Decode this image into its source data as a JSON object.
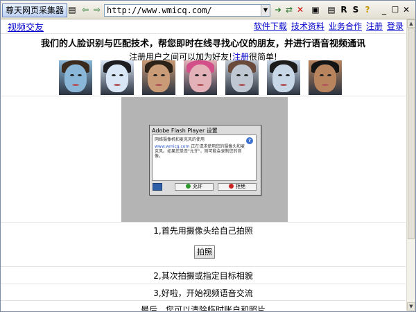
{
  "app": {
    "title": "尊天网页采集器",
    "url": "http://www.wmicq.com/"
  },
  "nav": {
    "brand": "视频交友",
    "links": [
      "软件下载",
      "技术资料",
      "业务合作",
      "注册",
      "登录"
    ]
  },
  "headline": "我们的人脸识别与匹配技术，帮您即时在线寻找心仪的朋友，并进行语音视频通讯",
  "subline": {
    "before": "注册用户之间可以加为好友!",
    "link": "注册",
    "after": "很简单!"
  },
  "faces": [
    {
      "tint": "#8ab7d8",
      "hair": "#3b2a1e"
    },
    {
      "tint": "#d9e6f6",
      "hair": "#1e1e22"
    },
    {
      "tint": "#c99b77",
      "hair": "#2c2218"
    },
    {
      "tint": "#e3b2b8",
      "hair": "#d24f8a"
    },
    {
      "tint": "#bfc7d2",
      "hair": "#6a4a3a"
    },
    {
      "tint": "#c8d7e8",
      "hair": "#1c1c1c"
    },
    {
      "tint": "#b7845e",
      "hair": "#141414"
    }
  ],
  "flash_dialog": {
    "title": "Adobe Flash Player 设置",
    "body_line1": "网络摄像机和麦克风的使用",
    "body_domain": "www.wmicq.com",
    "body_rest": "正在请求使用您的摄像头和麦克风。如果您单击\"允许\"，则可能会录制您的音像。",
    "allow": "允许",
    "deny": "拒绝"
  },
  "steps": {
    "step1": "1,首先用摄像头给自己拍照",
    "shoot_button": "拍照",
    "step2": "2,其次拍摄或指定目标相貌",
    "step3": "3,好啦，开始视频语音交流",
    "step4": "最后，您可以清除临时账户和照片"
  },
  "colors": {
    "link": "#0000cc",
    "flash_gray": "#b4b4b4"
  }
}
